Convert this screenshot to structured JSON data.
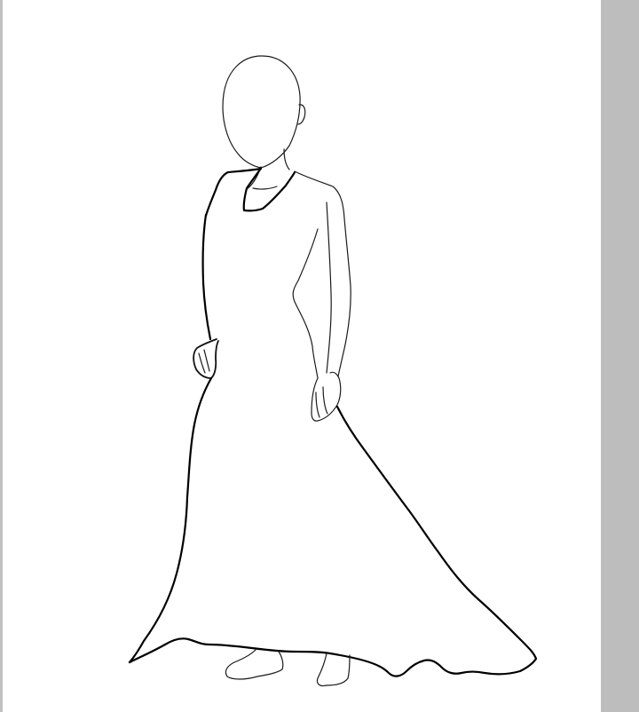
{
  "colors": {
    "background": "#ffffff",
    "line": "#000000",
    "left_border": "#c0c0c0",
    "scrollbar_track": "#bdbdbd",
    "scrollbar_thumb": "#bdbdbd"
  },
  "canvas": {
    "drawing": "line-art-figure-in-long-dress"
  }
}
